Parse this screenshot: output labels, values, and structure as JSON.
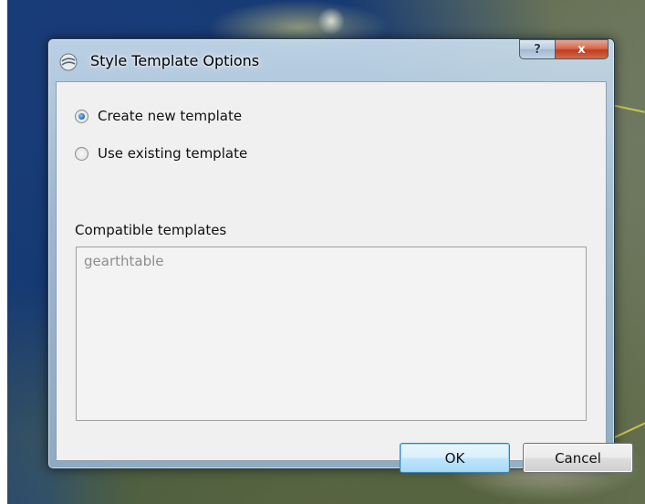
{
  "dialog": {
    "title": "Style Template Options",
    "help_label": "?",
    "close_label": "x"
  },
  "options": {
    "create_new": "Create new template",
    "use_existing": "Use existing template",
    "selected": "create_new"
  },
  "templates": {
    "label": "Compatible templates",
    "items": [
      "gearthtable"
    ]
  },
  "buttons": {
    "ok": "OK",
    "cancel": "Cancel"
  },
  "icons": {
    "app": "google-earth-icon",
    "help": "help-icon",
    "close": "close-icon"
  }
}
